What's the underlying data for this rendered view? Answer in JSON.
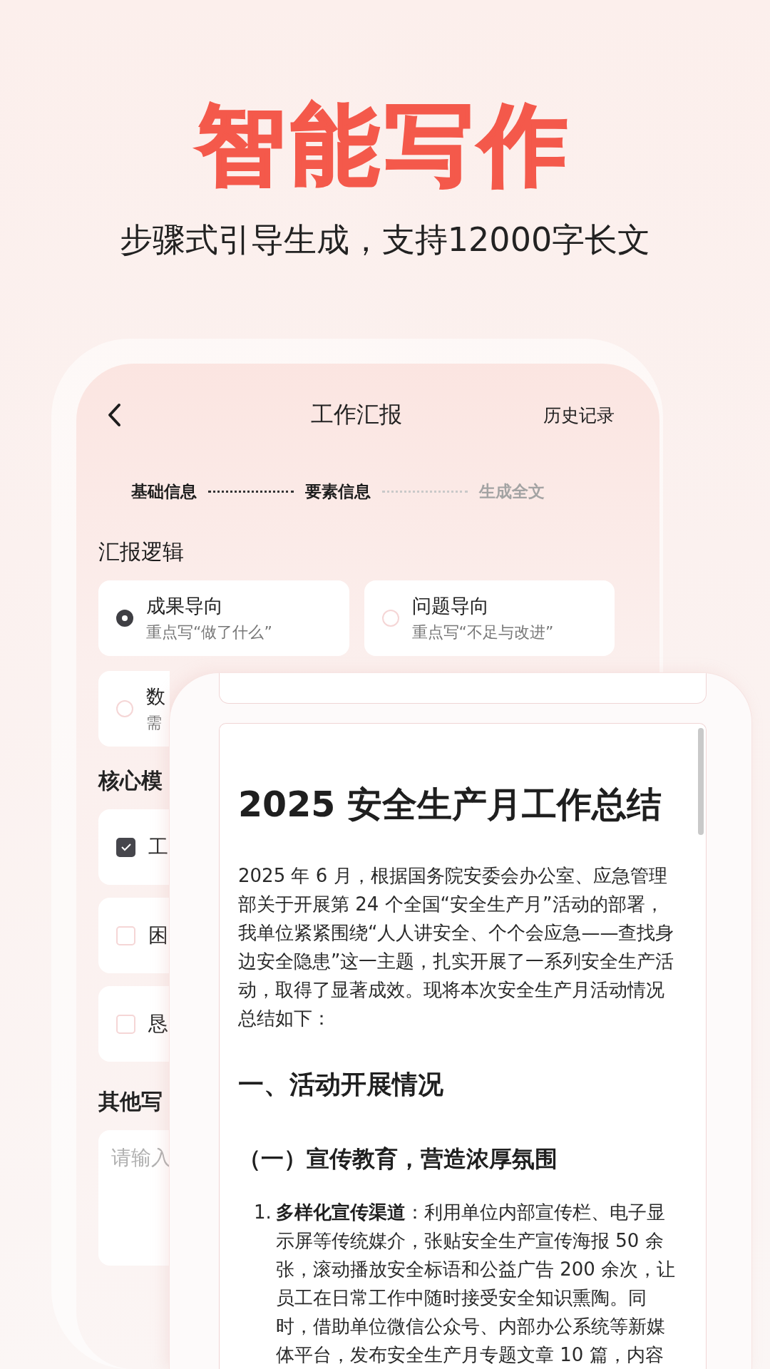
{
  "headline": "智能写作",
  "subtitle": "步骤式引导生成，支持12000字长文",
  "back_screen": {
    "nav": {
      "title": "工作汇报",
      "action": "历史记录"
    },
    "steps": [
      {
        "label": "基础信息",
        "active": true
      },
      {
        "label": "要素信息",
        "active": true
      },
      {
        "label": "生成全文",
        "active": false
      }
    ],
    "logic_section": {
      "title": "汇报逻辑",
      "options": [
        {
          "title": "成果导向",
          "hint": "重点写“做了什么”",
          "selected": true
        },
        {
          "title": "问题导向",
          "hint": "重点写“不足与改进”",
          "selected": false
        },
        {
          "title": "数",
          "hint": "需",
          "selected": false
        }
      ]
    },
    "modules_section": {
      "title": "核心模",
      "items": [
        {
          "label": "工",
          "checked": true
        },
        {
          "label": "困",
          "checked": false
        },
        {
          "label": "恳",
          "checked": false
        }
      ]
    },
    "other_section": {
      "title": "其他写",
      "placeholder": "请输入"
    }
  },
  "document": {
    "title": "2025 安全生产月工作总结",
    "intro": "2025 年 6 月，根据国务院安委会办公室、应急管理部关于开展第 24 个全国“安全生产月”活动的部署，我单位紧紧围绕“人人讲安全、个个会应急——查找身边安全隐患”这一主题，扎实开展了一系列安全生产活动，取得了显著成效。现将本次安全生产月活动情况总结如下：",
    "heading": "一、活动开展情况",
    "subheading": "（一）宣传教育，营造浓厚氛围",
    "list": [
      {
        "number": "1.",
        "text": "**多样化宣传渠道**：利用单位内部宣传栏、电子显示屏等传统媒介，张贴安全生产宣传海报 50 余张，滚动播放安全标语和公益广告 200 余次，让员工在日常工作中随时接受安全知识熏陶。同时，借助单位微信公众号、内部办公系统等新媒体平台，发布安全生产月专题文章 10 篇，内容"
      }
    ]
  }
}
